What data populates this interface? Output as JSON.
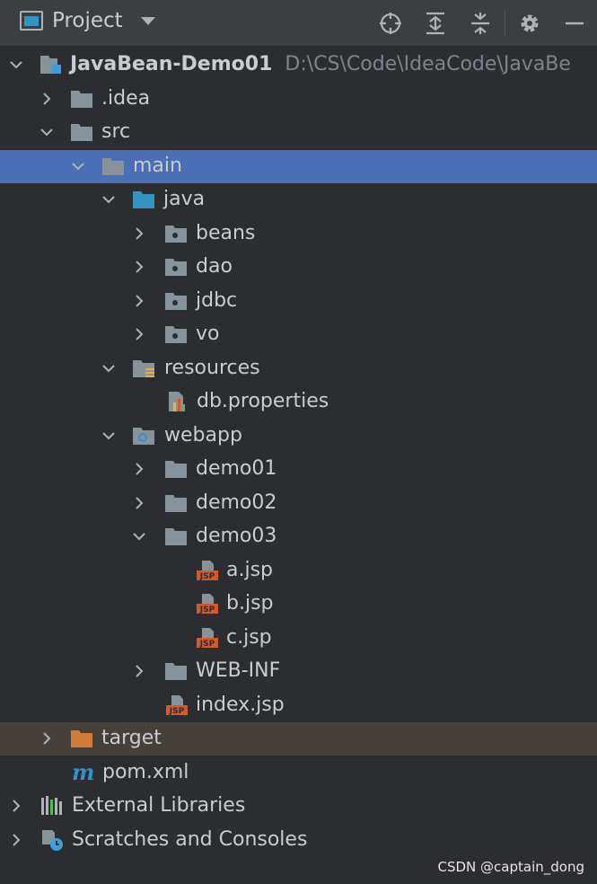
{
  "toolbar": {
    "title": "Project"
  },
  "tree": {
    "root": {
      "label": "JavaBean-Demo01",
      "path": "D:\\CS\\Code\\IdeaCode\\JavaBe"
    },
    "idea": ".idea",
    "src": "src",
    "main": "main",
    "java": "java",
    "beans": "beans",
    "dao": "dao",
    "jdbc": "jdbc",
    "vo": "vo",
    "resources": "resources",
    "db_properties": "db.properties",
    "webapp": "webapp",
    "demo01": "demo01",
    "demo02": "demo02",
    "demo03": "demo03",
    "a_jsp": "a.jsp",
    "b_jsp": "b.jsp",
    "c_jsp": "c.jsp",
    "web_inf": "WEB-INF",
    "index_jsp": "index.jsp",
    "target": "target",
    "pom_xml": "pom.xml",
    "external_libraries": "External Libraries",
    "scratches": "Scratches and Consoles"
  },
  "watermark": "CSDN @captain_dong",
  "colors": {
    "selection": "#4a6fb5",
    "excluded": "#45403a",
    "folder": "#87939a",
    "source_folder": "#3592c4",
    "target_folder": "#d57b3a",
    "jsp": "#d5592b"
  }
}
